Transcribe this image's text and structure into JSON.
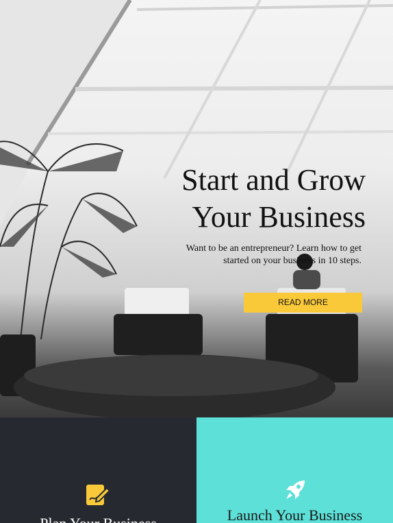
{
  "hero": {
    "title_line1": "Start and Grow",
    "title_line2": "Your Business",
    "subtitle": "Want to be an entrepreneur? Learn how to get started on your business in 10 steps.",
    "cta_label": "READ MORE",
    "cta_color": "#f9c93a"
  },
  "panels": [
    {
      "title": "Plan Your Business",
      "icon": "pencil-document-icon",
      "background": "#262a30",
      "icon_color": "#f9c93a"
    },
    {
      "title": "Launch Your Business",
      "icon": "rocket-icon",
      "background": "#5ce0d8",
      "icon_color": "#ffffff"
    }
  ]
}
